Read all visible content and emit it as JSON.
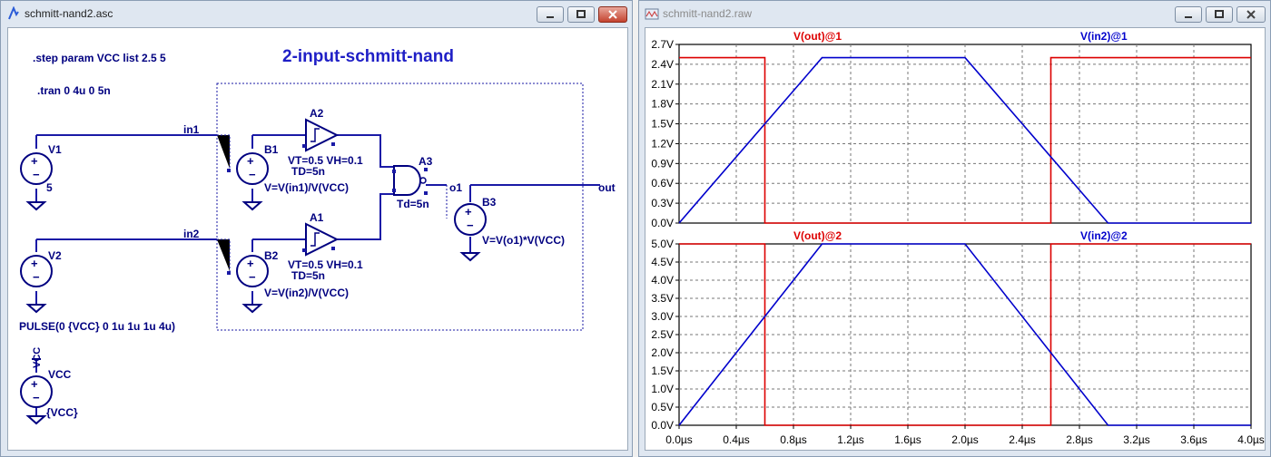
{
  "schematic_window": {
    "title": "schmitt-nand2.asc",
    "diagram_title": "2-input-schmitt-nand",
    "directives": [
      ".step param VCC list 2.5 5",
      ".tran 0 4u 0 5n"
    ],
    "sources": {
      "v1_name": "V1",
      "v1_value": "5",
      "v2_name": "V2",
      "v2_value": "PULSE(0 {VCC} 0 1u 1u 1u 4u)",
      "vcc_name": "VCC",
      "vcc_value": "{VCC}",
      "vcc_net": "VCC"
    },
    "nets": {
      "in1": "in1",
      "in2": "in2",
      "o1": "o1",
      "out": "out"
    },
    "components": {
      "b1_name": "B1",
      "b1_expr": "V=V(in1)/V(VCC)",
      "b2_name": "B2",
      "b2_expr": "V=V(in2)/V(VCC)",
      "b3_name": "B3",
      "b3_expr": "V=V(o1)*V(VCC)",
      "a1_name": "A1",
      "a1_params_1": "VT=0.5 VH=0.1",
      "a1_params_2": "TD=5n",
      "a2_name": "A2",
      "a2_params_1": "VT=0.5 VH=0.1",
      "a2_params_2": "TD=5n",
      "a3_name": "A3",
      "a3_param": "Td=5n"
    },
    "colors": {
      "wire": "#1a1aa6",
      "symbol": "#000080",
      "title": "#1f1fc6"
    }
  },
  "waveform_window": {
    "title": "schmitt-nand2.raw",
    "panes": [
      {
        "trace_left": "V(out)@1",
        "trace_right": "V(in2)@1",
        "y_ticks": [
          "2.7V",
          "2.4V",
          "2.1V",
          "1.8V",
          "1.5V",
          "1.2V",
          "0.9V",
          "0.6V",
          "0.3V",
          "0.0V"
        ]
      },
      {
        "trace_left": "V(out)@2",
        "trace_right": "V(in2)@2",
        "y_ticks": [
          "5.0V",
          "4.5V",
          "4.0V",
          "3.5V",
          "3.0V",
          "2.5V",
          "2.0V",
          "1.5V",
          "1.0V",
          "0.5V",
          "0.0V"
        ]
      }
    ],
    "x_ticks": [
      "0.0µs",
      "0.4µs",
      "0.8µs",
      "1.2µs",
      "1.6µs",
      "2.0µs",
      "2.4µs",
      "2.8µs",
      "3.2µs",
      "3.6µs",
      "4.0µs"
    ]
  },
  "chart_data": [
    {
      "type": "line",
      "grid": true,
      "xlim": [
        0,
        4.0
      ],
      "ylim": [
        0,
        2.7
      ],
      "series": [
        {
          "name": "V(out)@1",
          "color": "#dd0000",
          "x": [
            0,
            0.6,
            0.6,
            2.6,
            2.6,
            4.0
          ],
          "values": [
            2.5,
            2.5,
            0,
            0,
            2.5,
            2.5
          ]
        },
        {
          "name": "V(in2)@1",
          "color": "#0000cc",
          "x": [
            0,
            1.0,
            2.0,
            3.0,
            4.0
          ],
          "values": [
            0,
            2.5,
            2.5,
            0,
            0
          ]
        }
      ]
    },
    {
      "type": "line",
      "grid": true,
      "xlim": [
        0,
        4.0
      ],
      "ylim": [
        0,
        5.0
      ],
      "series": [
        {
          "name": "V(out)@2",
          "color": "#dd0000",
          "x": [
            0,
            0.6,
            0.6,
            2.6,
            2.6,
            4.0
          ],
          "values": [
            5,
            5,
            0,
            0,
            5,
            5
          ]
        },
        {
          "name": "V(in2)@2",
          "color": "#0000cc",
          "x": [
            0,
            1.0,
            2.0,
            3.0,
            4.0
          ],
          "values": [
            0,
            5,
            5,
            0,
            0
          ]
        }
      ]
    }
  ]
}
